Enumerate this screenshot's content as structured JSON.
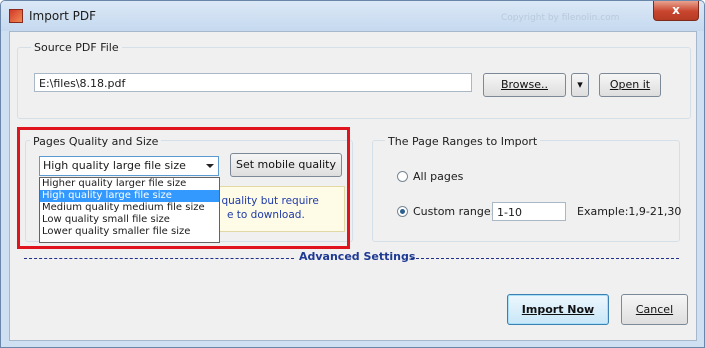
{
  "window": {
    "title": "Import PDF",
    "watermark": "Copyright by filenolin.com",
    "close_glyph": "x"
  },
  "source": {
    "group_label": "Source PDF File",
    "path_value": "E:\\files\\8.18.pdf",
    "browse_label": "Browse..",
    "dropdown_glyph": "▾",
    "open_label": "Open it"
  },
  "quality": {
    "group_label": "Pages Quality and Size",
    "selected": "High quality large file size",
    "mobile_button": "Set mobile quality",
    "options": [
      "Higher quality larger file size",
      "High quality large file size",
      "Medium quality medium file size",
      "Low quality small file size",
      "Lower quality smaller file size"
    ],
    "notice_line1": "ge quality but require",
    "notice_line2": "e to download."
  },
  "ranges": {
    "group_label": "The Page Ranges to Import",
    "all_pages_label": "All pages",
    "custom_label": "Custom range:",
    "custom_value": "1-10",
    "example_text": "Example:1,9-21,30",
    "selected_option": "custom"
  },
  "advanced": {
    "label": "Advanced Settings"
  },
  "actions": {
    "import_label": "Import Now",
    "cancel_label": "Cancel"
  },
  "colors": {
    "highlight_box": "#e0141d",
    "selection": "#3399ff",
    "advanced_label": "#1f3a93"
  }
}
